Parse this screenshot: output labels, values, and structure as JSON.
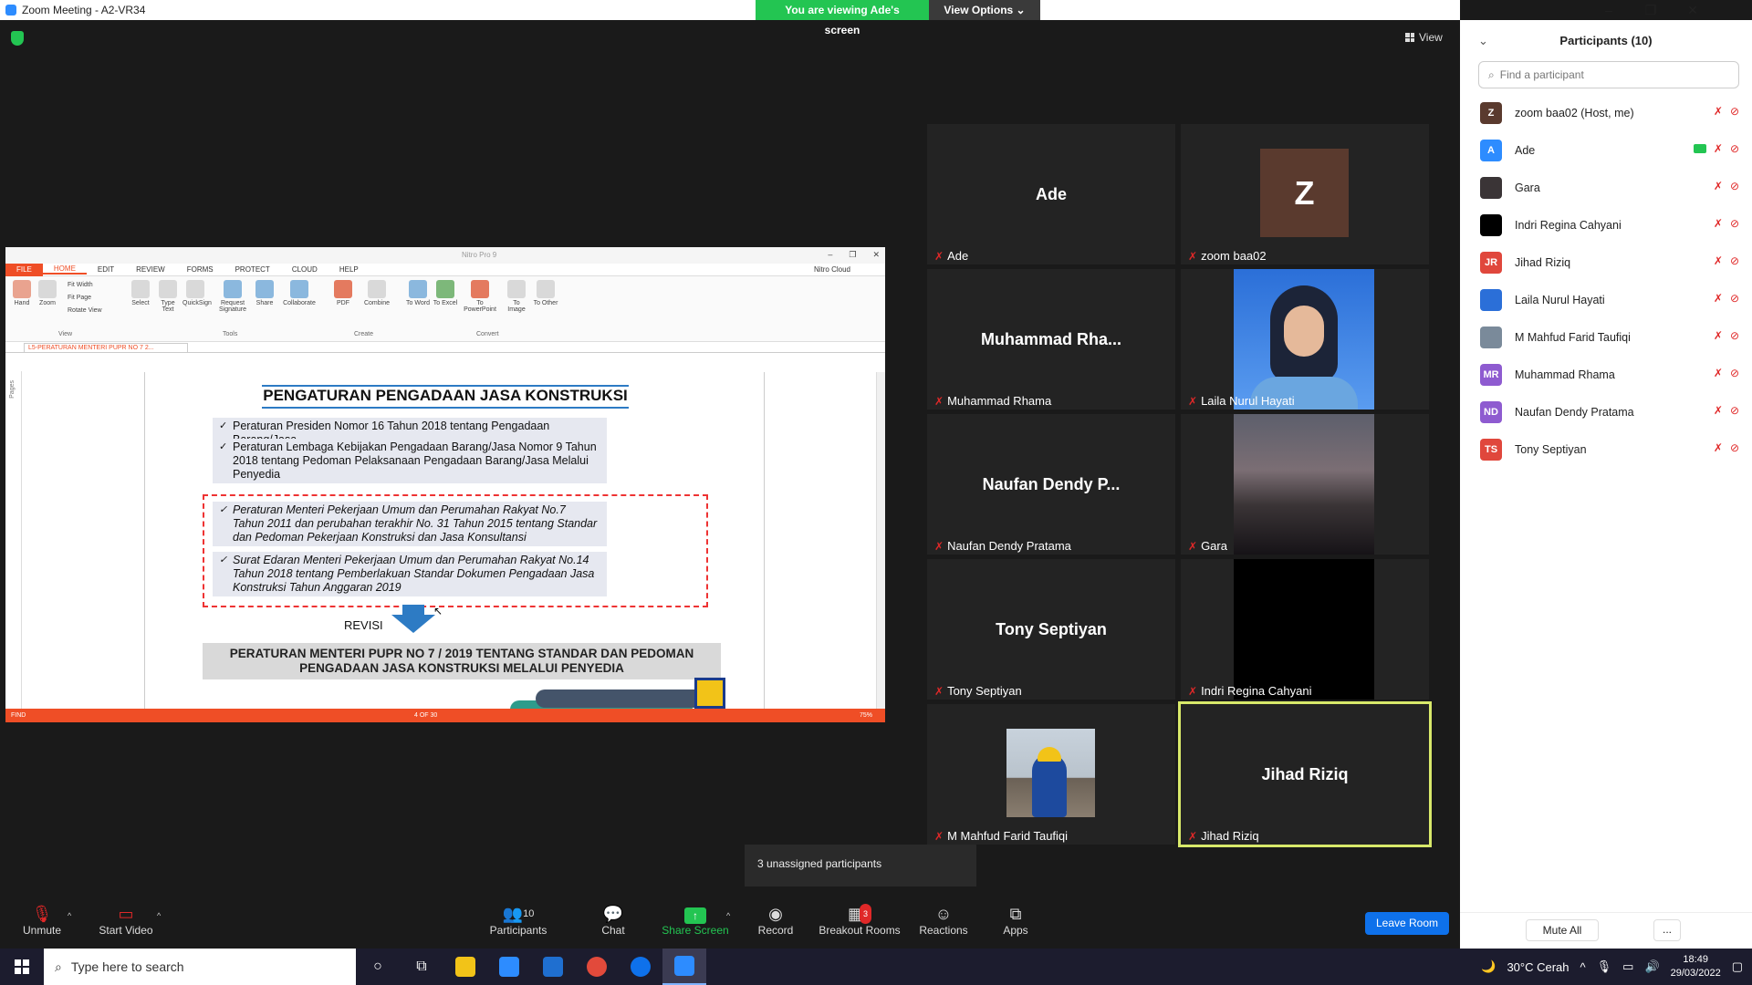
{
  "window": {
    "title": "Zoom Meeting - A2-VR34"
  },
  "banner": {
    "viewing": "You are viewing Ade's screen",
    "view_options": "View Options ⌄"
  },
  "view_button": {
    "label": "View"
  },
  "nitro": {
    "window_title": "Nitro Pro 9",
    "menu": [
      "FILE",
      "HOME",
      "EDIT",
      "REVIEW",
      "FORMS",
      "PROTECT",
      "CLOUD",
      "HELP"
    ],
    "cloud_user": "Nitro Cloud",
    "ribbon_view": [
      "Hand",
      "Zoom"
    ],
    "ribbon_view_small": [
      "Fit Width",
      "Fit Page",
      "Rotate View"
    ],
    "ribbon_tools": [
      "Select",
      "Type Text",
      "QuickSign",
      "Request Signature",
      "Share",
      "Collaborate"
    ],
    "ribbon_create": [
      "PDF",
      "Combine"
    ],
    "ribbon_convert": [
      "To Word",
      "To Excel",
      "To PowerPoint",
      "To Image",
      "To Other"
    ],
    "groups": {
      "view": "View",
      "tools": "Tools",
      "create": "Create",
      "convert": "Convert"
    },
    "doc_tab": "L5-PERATURAN MENTERI PUPR NO 7 2...",
    "pages_label": "Pages",
    "status_find": "FIND",
    "status_page": "4 OF 30",
    "status_zoom": "75%",
    "doc": {
      "title": "PENGATURAN PENGADAAN JASA KONSTRUKSI",
      "rules": [
        "Peraturan Presiden Nomor 16 Tahun 2018 tentang Pengadaan Barang/Jasa",
        "Peraturan Lembaga Kebijakan Pengadaan Barang/Jasa Nomor 9 Tahun 2018 tentang Pedoman Pelaksanaan Pengadaan Barang/Jasa Melalui Penyedia",
        "Peraturan Menteri Pekerjaan Umum dan Perumahan Rakyat No.7 Tahun 2011 dan perubahan terakhir No. 31 Tahun 2015  tentang Standar dan Pedoman Pekerjaan Konstruksi dan Jasa Konsultansi",
        "Surat Edaran Menteri Pekerjaan Umum dan Perumahan Rakyat No.14 Tahun 2018 tentang Pemberlakuan Standar Dokumen Pengadaan Jasa Konstruksi Tahun Anggaran 2019"
      ],
      "revisi": "REVISI",
      "result": "PERATURAN MENTERI PUPR NO 7 / 2019 TENTANG STANDAR DAN PEDOMAN PENGADAAN JASA KONSTRUKSI MELALUI PENYEDIA",
      "slide_number": "4"
    }
  },
  "tiles": [
    {
      "big": "Ade",
      "label": "Ade"
    },
    {
      "big": "Z",
      "label": "zoom baa02"
    },
    {
      "big": "Muhammad  Rha...",
      "label": "Muhammad Rhama"
    },
    {
      "big": "",
      "label": "Laila Nurul Hayati"
    },
    {
      "big": "Naufan  Dendy  P...",
      "label": "Naufan Dendy Pratama"
    },
    {
      "big": "",
      "label": "Gara"
    },
    {
      "big": "Tony  Septiyan",
      "label": "Tony Septiyan"
    },
    {
      "big": "",
      "label": "Indri Regina Cahyani"
    },
    {
      "big": "",
      "label": "M Mahfud Farid Taufiqi"
    },
    {
      "big": "Jihad  Riziq",
      "label": "Jihad Riziq"
    }
  ],
  "unassigned": "3 unassigned participants",
  "toolbar": {
    "unmute": "Unmute",
    "start_video": "Start Video",
    "participants": "Participants",
    "participants_count": "10",
    "chat": "Chat",
    "share_screen": "Share Screen",
    "record": "Record",
    "breakout": "Breakout Rooms",
    "breakout_badge": "3",
    "reactions": "Reactions",
    "apps": "Apps",
    "leave": "Leave Room"
  },
  "panel": {
    "title": "Participants (10)",
    "search_placeholder": "Find a participant",
    "participants": [
      {
        "initials": "Z",
        "name": "zoom baa02 (Host, me)",
        "color": "#5a3a2e"
      },
      {
        "initials": "A",
        "name": "Ade",
        "color": "#2d8cff"
      },
      {
        "initials": "",
        "name": "Gara",
        "color": "#3a3436"
      },
      {
        "initials": "",
        "name": "Indri Regina Cahyani",
        "color": "#000000"
      },
      {
        "initials": "JR",
        "name": "Jihad Riziq",
        "color": "#e0473c"
      },
      {
        "initials": "",
        "name": "Laila Nurul Hayati",
        "color": "#2b6fd8"
      },
      {
        "initials": "",
        "name": "M Mahfud Farid Taufiqi",
        "color": "#7a8a9a"
      },
      {
        "initials": "MR",
        "name": "Muhammad Rhama",
        "color": "#8e5bd0"
      },
      {
        "initials": "ND",
        "name": "Naufan Dendy Pratama",
        "color": "#8e5bd0"
      },
      {
        "initials": "TS",
        "name": "Tony Septiyan",
        "color": "#e0473c"
      }
    ],
    "mute_all": "Mute All",
    "more": "..."
  },
  "taskbar": {
    "search_placeholder": "Type here to search",
    "weather": "30°C  Cerah",
    "time": "18:49",
    "date": "29/03/2022"
  }
}
